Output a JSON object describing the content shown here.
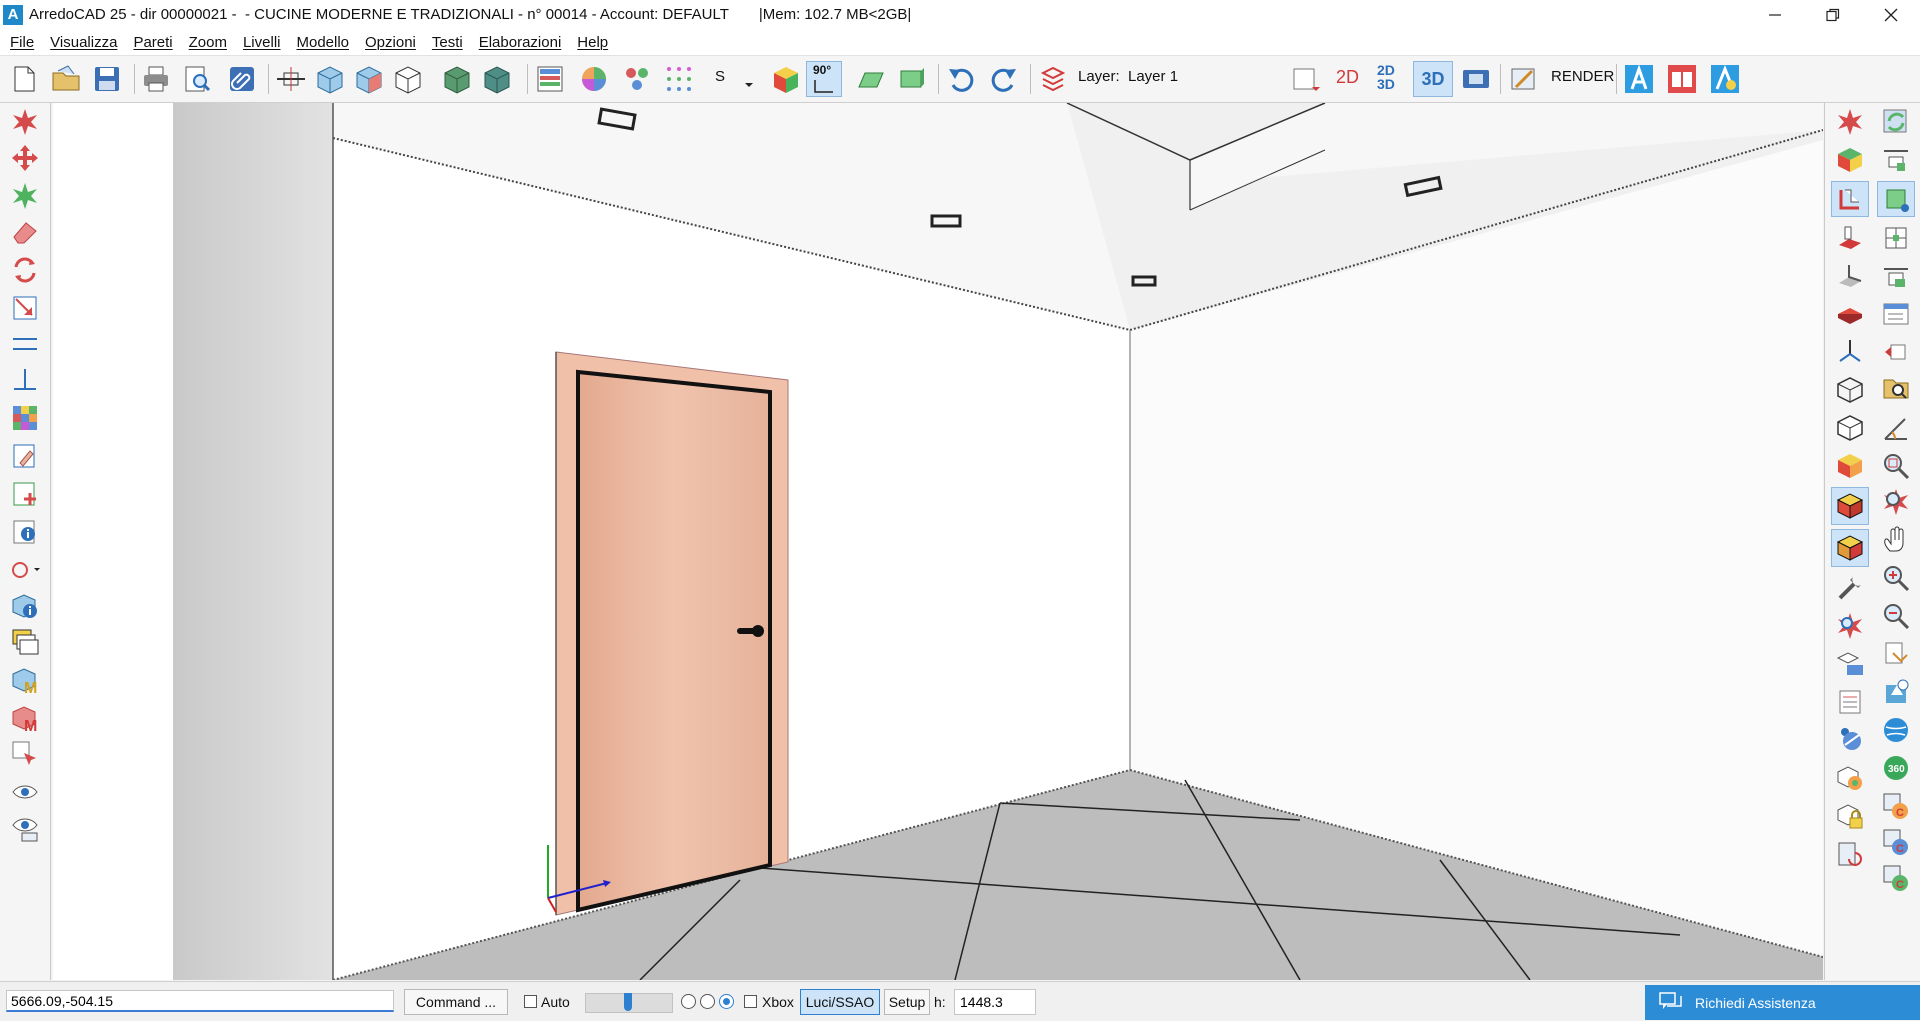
{
  "window": {
    "title": "ArredoCAD 25 - dir 00000021 -  - CUCINE MODERNE E TRADIZIONALI - n° 00014 - Account: DEFAULT",
    "memory": "|Mem: 102.7 MB<2GB|",
    "logo_letter": "A"
  },
  "menu": [
    "File",
    "Visualizza",
    "Pareti",
    "Zoom",
    "Livelli",
    "Modello",
    "Opzioni",
    "Testi",
    "Elaborazioni",
    "Help"
  ],
  "toolbar": {
    "s_label": "S",
    "angle_label": "90°",
    "layer_caption": "Layer:",
    "layer_value": "Layer 1",
    "view_2d": "2D",
    "view_2d3d_top": "2D",
    "view_2d3d_bottom": "3D",
    "view_3d": "3D",
    "render_label": "RENDER"
  },
  "colors": {
    "accent": "#2d8cd6",
    "door": "#e8b59b",
    "floor": "#bdbdbd",
    "axis_x": "#2222cc",
    "axis_y": "#22aa22",
    "axis_z": "#cc2222"
  },
  "statusbar": {
    "coordinates": "5666.09,-504.15",
    "command_button": "Command ...",
    "auto_label": "Auto",
    "xbox_label": "Xbox",
    "lights_button": "Luci/SSAO",
    "setup_button": "Setup",
    "h_label": "h:",
    "h_value": "1448.3",
    "assist_button": "Richiedi Assistenza"
  }
}
